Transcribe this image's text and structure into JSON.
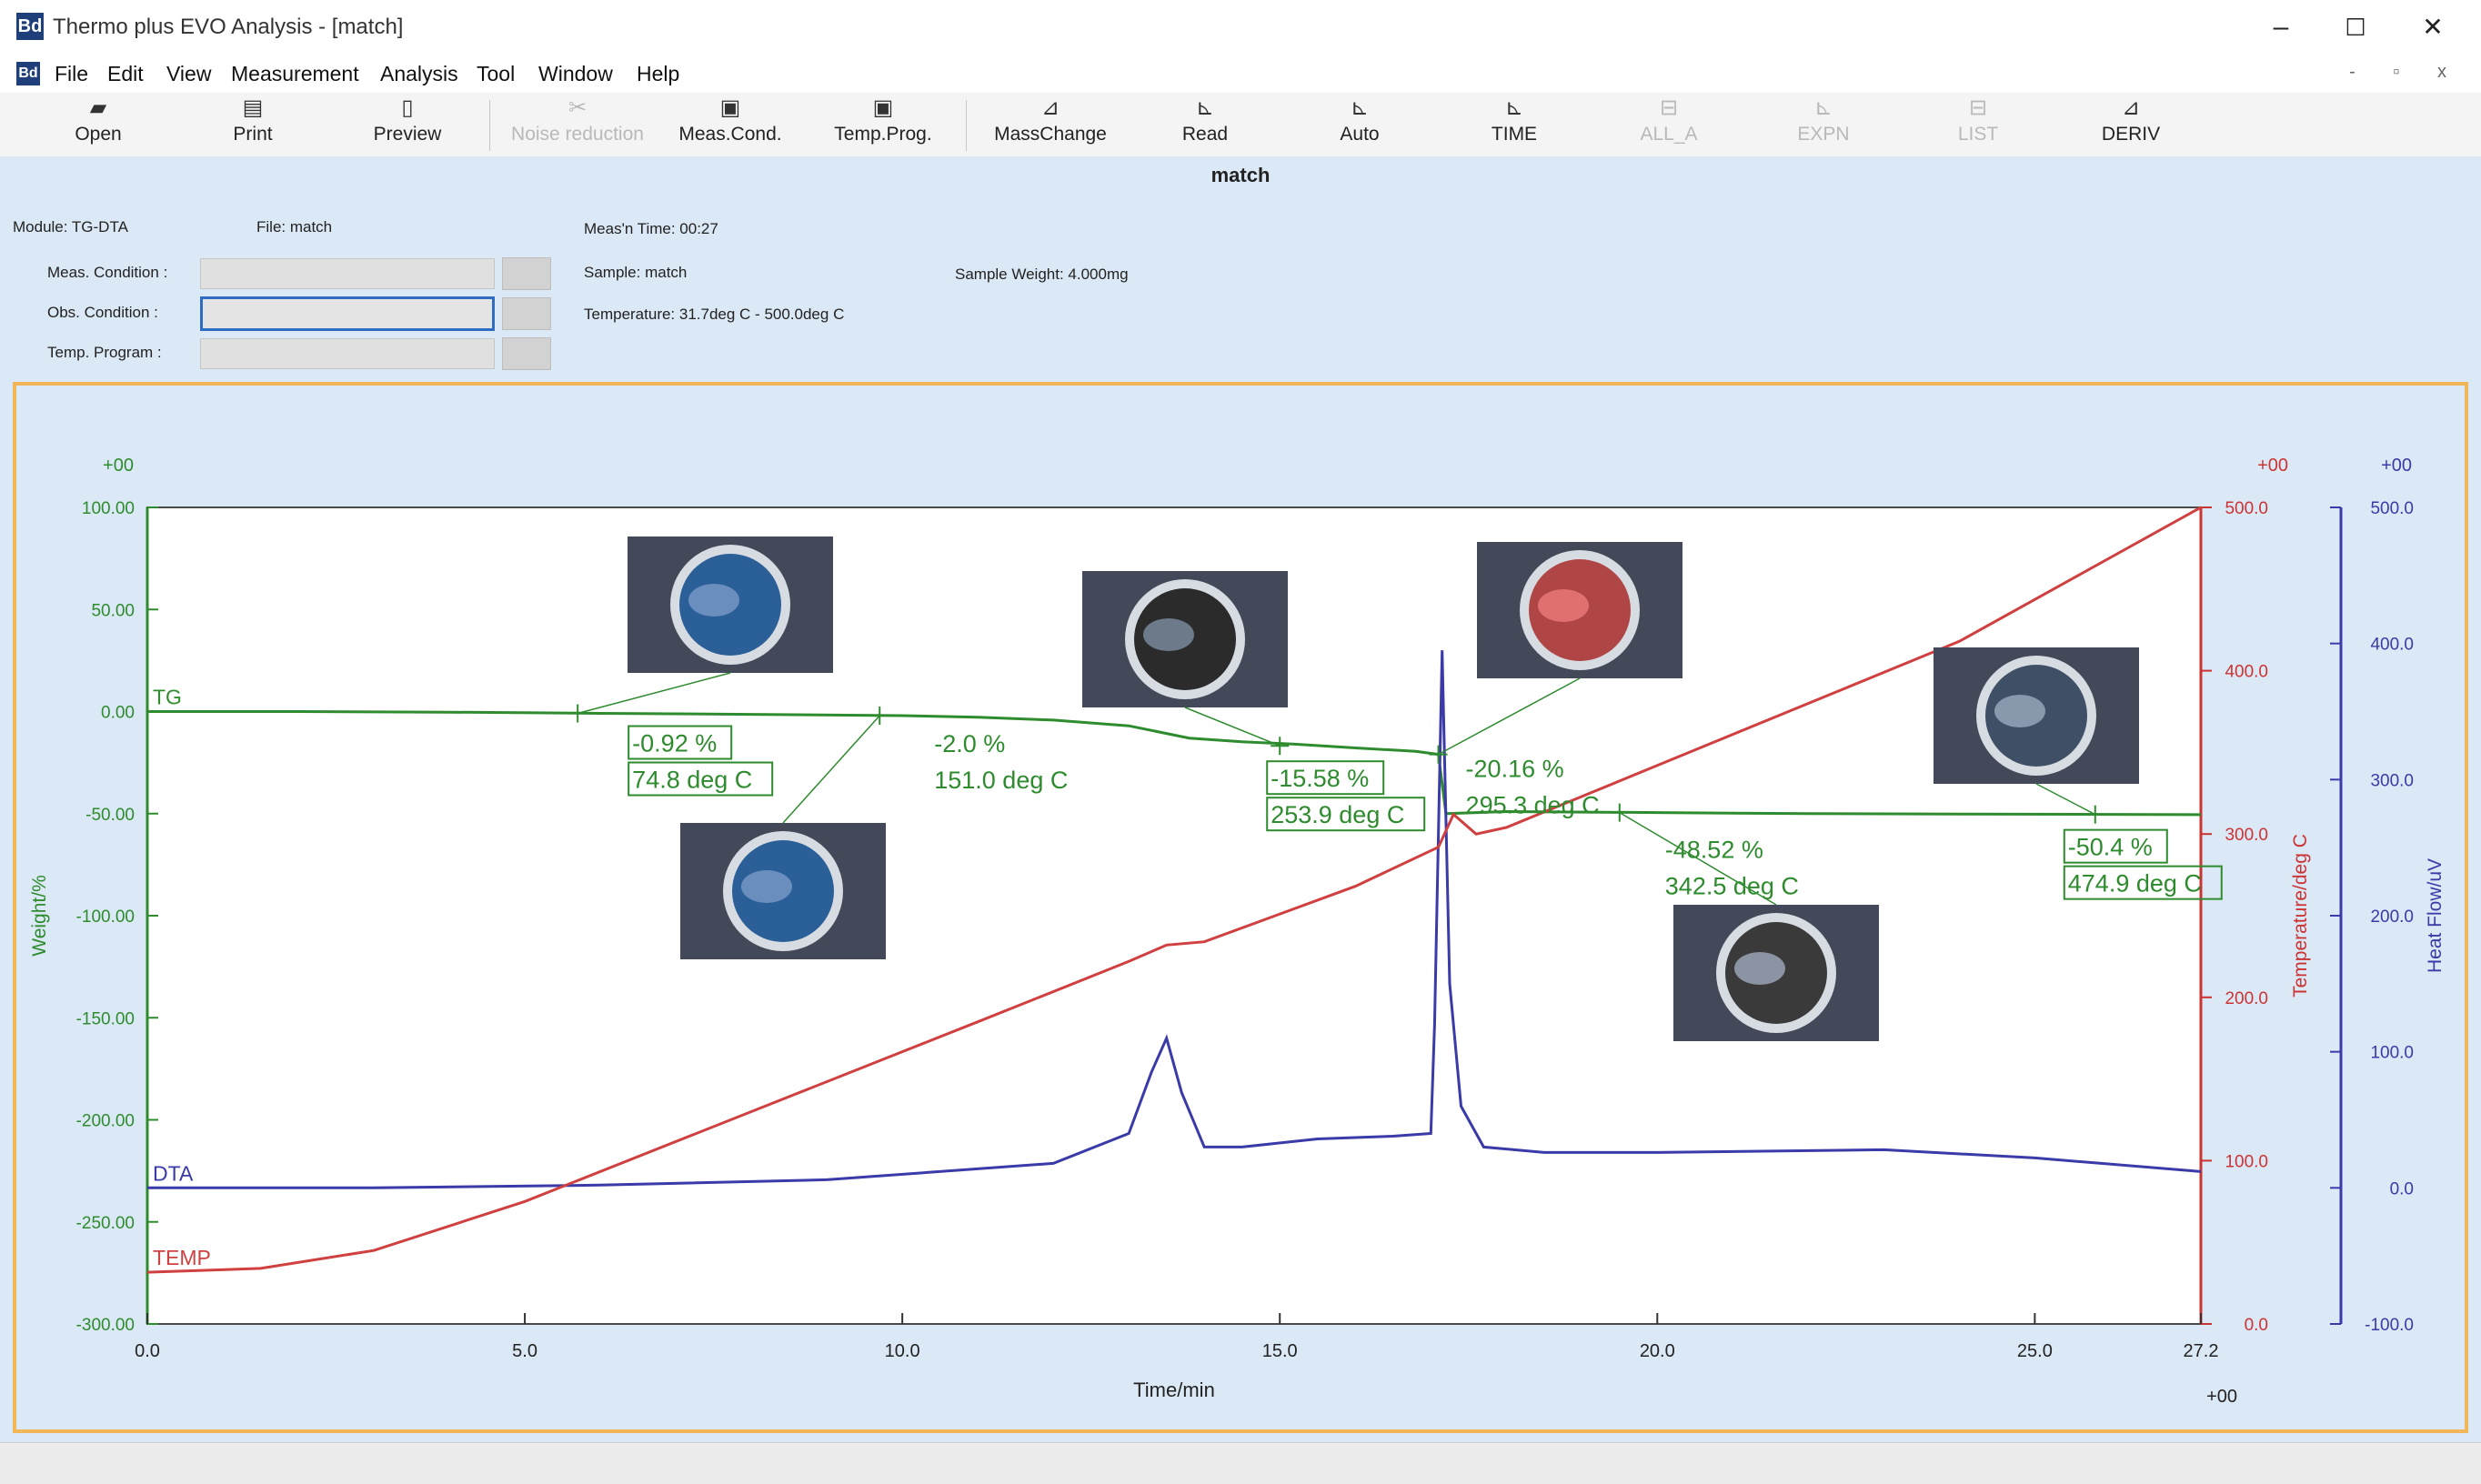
{
  "window": {
    "title": "Thermo plus EVO Analysis - [match]",
    "app_icon": "Bd",
    "minimize": "–",
    "maximize": "☐",
    "close": "✕"
  },
  "menu": {
    "items": [
      "File",
      "Edit",
      "View",
      "Measurement",
      "Analysis",
      "Tool",
      "Window",
      "Help"
    ],
    "mdi_buttons": "- ▫ x"
  },
  "toolbar": {
    "buttons": [
      {
        "label": "Open",
        "icon": "open-folder-icon",
        "enabled": true
      },
      {
        "label": "Print",
        "icon": "printer-icon",
        "enabled": true
      },
      {
        "label": "Preview",
        "icon": "preview-icon",
        "enabled": true
      },
      {
        "label": "Noise reduction",
        "icon": "noise-reduction-icon",
        "enabled": false
      },
      {
        "label": "Meas.Cond.",
        "icon": "meas-cond-icon",
        "enabled": true
      },
      {
        "label": "Temp.Prog.",
        "icon": "temp-prog-icon",
        "enabled": true
      },
      {
        "label": "MassChange",
        "icon": "mass-change-icon",
        "enabled": true
      },
      {
        "label": "Read",
        "icon": "read-icon",
        "enabled": true
      },
      {
        "label": "Auto",
        "icon": "auto-icon",
        "enabled": true
      },
      {
        "label": "TIME",
        "icon": "time-icon",
        "enabled": true
      },
      {
        "label": "ALL_A",
        "icon": "all-a-icon",
        "enabled": false
      },
      {
        "label": "EXPN",
        "icon": "expn-icon",
        "enabled": false
      },
      {
        "label": "LIST",
        "icon": "list-icon",
        "enabled": false
      },
      {
        "label": "DERIV",
        "icon": "deriv-icon",
        "enabled": true
      }
    ]
  },
  "info": {
    "doc_title": "match",
    "module": "Module: TG-DTA",
    "file": "File: match",
    "meas_time": "Meas'n Time: 00:27",
    "sample": "Sample: match",
    "sample_weight": "Sample Weight: 4.000mg",
    "temperature": "Temperature: 31.7deg C - 500.0deg C",
    "meas_condition": "Meas. Condition :",
    "obs_condition": "Obs. Condition :",
    "temp_program": "Temp. Program :"
  },
  "chart_data": {
    "type": "line",
    "xlabel": "Time/min",
    "x_exp": "+00",
    "xlim": [
      0,
      27.2
    ],
    "x_ticks": [
      "0.0",
      "5.0",
      "10.0",
      "15.0",
      "20.0",
      "25.0",
      "27.2"
    ],
    "left_axis": {
      "label": "Weight/%",
      "exp": "+00",
      "lim": [
        -300,
        100
      ],
      "ticks": [
        "100.00",
        "50.00",
        "0.00",
        "-50.00",
        "-100.00",
        "-150.00",
        "-200.00",
        "-250.00",
        "-300.00"
      ],
      "color": "#2e8b2e"
    },
    "right_axis_1": {
      "label": "Temperature/deg C",
      "exp": "+00",
      "lim": [
        0,
        500
      ],
      "ticks": [
        "500.0",
        "400.0",
        "300.0",
        "200.0",
        "100.0",
        "0.0"
      ],
      "color": "#cc3333"
    },
    "right_axis_2": {
      "label": "Heat Flow/uV",
      "exp": "+00",
      "lim": [
        -100,
        500
      ],
      "ticks": [
        "500.0",
        "400.0",
        "300.0",
        "200.0",
        "100.0",
        "0.0",
        "-100.0"
      ],
      "color": "#3a3aa8"
    },
    "series": [
      {
        "name": "TG",
        "color": "#2e8b2e",
        "axis": "left",
        "x": [
          0,
          2,
          4,
          6,
          8,
          10,
          11,
          12,
          13,
          13.8,
          14.5,
          15.2,
          16,
          16.8,
          17.1,
          17.2,
          18,
          20,
          22,
          24,
          26,
          27.2
        ],
        "y": [
          0,
          0,
          -0.3,
          -0.9,
          -1.4,
          -2.0,
          -2.8,
          -4.2,
          -7,
          -13,
          -14.8,
          -16,
          -17.8,
          -19.5,
          -21,
          -50,
          -49,
          -49.5,
          -50,
          -50.2,
          -50.4,
          -50.5
        ]
      },
      {
        "name": "DTA",
        "color": "#3a3aa8",
        "axis": "right2",
        "x": [
          0,
          3,
          6,
          9,
          12,
          13.0,
          13.3,
          13.5,
          13.7,
          14.0,
          14.5,
          15.5,
          16.5,
          17.0,
          17.05,
          17.15,
          17.25,
          17.4,
          17.7,
          18.5,
          20,
          23,
          25,
          27.2
        ],
        "y": [
          0,
          0,
          2,
          6,
          18,
          40,
          85,
          110,
          70,
          30,
          30,
          36,
          38,
          40,
          120,
          395,
          150,
          60,
          30,
          26,
          26,
          28,
          22,
          12
        ]
      },
      {
        "name": "TEMP",
        "color": "#d04040",
        "axis": "right1",
        "x": [
          0,
          1.5,
          3,
          5,
          8,
          11,
          13,
          13.5,
          14,
          16,
          17.1,
          17.3,
          17.6,
          18,
          20,
          24,
          27.2
        ],
        "y": [
          31.7,
          34,
          45,
          75,
          130,
          185,
          222,
          232,
          234,
          268,
          292,
          312,
          300,
          304,
          342,
          418,
          500
        ]
      }
    ],
    "annotations": [
      {
        "series": "TG",
        "x": 5.7,
        "y": -0.9,
        "text": [
          "-0.92 %",
          "74.8 deg C"
        ],
        "boxed": true
      },
      {
        "series": "TG",
        "x": 9.7,
        "y": -2.0,
        "text": [
          "-2.0 %",
          "151.0 deg C"
        ],
        "boxed": false
      },
      {
        "series": "TG",
        "x": 15.0,
        "y": -16.8,
        "text": [
          "-15.58 %",
          "253.9 deg C"
        ],
        "boxed": true
      },
      {
        "series": "TG",
        "x": 17.1,
        "y": -21,
        "text": [
          "-20.16 %",
          "295.3 deg C"
        ],
        "boxed": false
      },
      {
        "series": "TG",
        "x": 19.5,
        "y": -49.5,
        "text": [
          "-48.52 %",
          "342.5 deg C"
        ],
        "boxed": false
      },
      {
        "series": "TG",
        "x": 25.8,
        "y": -50.4,
        "text": [
          "-50.4 %",
          "474.9 deg C"
        ],
        "boxed": true
      }
    ],
    "grid": false
  }
}
